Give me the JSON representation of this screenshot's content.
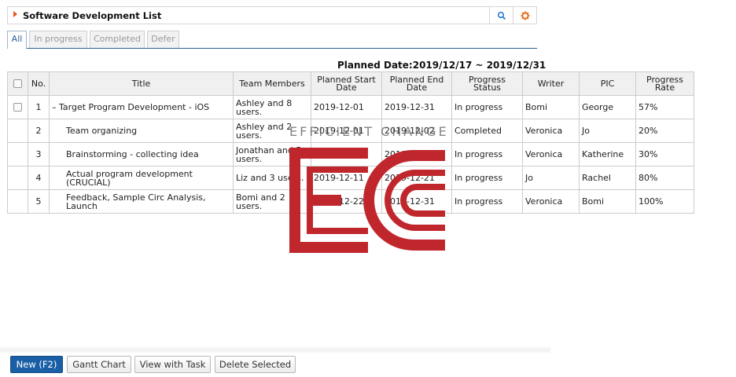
{
  "header": {
    "title": "Software Development List",
    "icons": [
      "search-icon",
      "gear-icon"
    ]
  },
  "tabs": [
    {
      "label": "All",
      "active": true
    },
    {
      "label": "In progress",
      "active": false
    },
    {
      "label": "Completed",
      "active": false
    },
    {
      "label": "Defer",
      "active": false
    }
  ],
  "planned_date": "Planned Date:2019/12/17 ~ 2019/12/31",
  "table": {
    "columns": [
      "No.",
      "Title",
      "Team Members",
      "Planned Start Date",
      "Planned End Date",
      "Progress Status",
      "Writer",
      "PIC",
      "Progress Rate"
    ],
    "rows": [
      {
        "no": "1",
        "title": "– Target Program Development - iOS",
        "members": "Ashley and 8 users.",
        "start": "2019-12-01",
        "end": "2019-12-31",
        "status": "In progress",
        "writer": "Bomi",
        "pic": "George",
        "rate": "57%"
      },
      {
        "no": "2",
        "title": "Team organizing",
        "members": "Ashley and 2 users.",
        "start": "2019-12-01",
        "end": "2019-12-02",
        "status": "Completed",
        "writer": "Veronica",
        "pic": "Jo",
        "rate": "20%"
      },
      {
        "no": "3",
        "title": "Brainstorming - collecting idea",
        "members": "Jonathan and 5 users.",
        "start": "2019-12-03",
        "end": "2019-12-10",
        "status": "In progress",
        "writer": "Veronica",
        "pic": "Katherine",
        "rate": "30%"
      },
      {
        "no": "4",
        "title": "Actual program development (CRUCIAL)",
        "members": "Liz and 3 users.",
        "start": "2019-12-11",
        "end": "2019-12-21",
        "status": "In progress",
        "writer": "Jo",
        "pic": "Rachel",
        "rate": "80%"
      },
      {
        "no": "5",
        "title": "Feedback, Sample Circ Analysis, Launch",
        "members": "Bomi and 2 users.",
        "start": "2019-12-22",
        "end": "2019-12-31",
        "status": "In progress",
        "writer": "Veronica",
        "pic": "Bomi",
        "rate": "100%"
      }
    ]
  },
  "watermark": {
    "text": "EFFICIENT CHANGE",
    "color": "#c0272d"
  },
  "footer": {
    "new_label": "New (F2)",
    "gantt_label": "Gantt Chart",
    "view_task_label": "View with Task",
    "delete_label": "Delete Selected"
  }
}
